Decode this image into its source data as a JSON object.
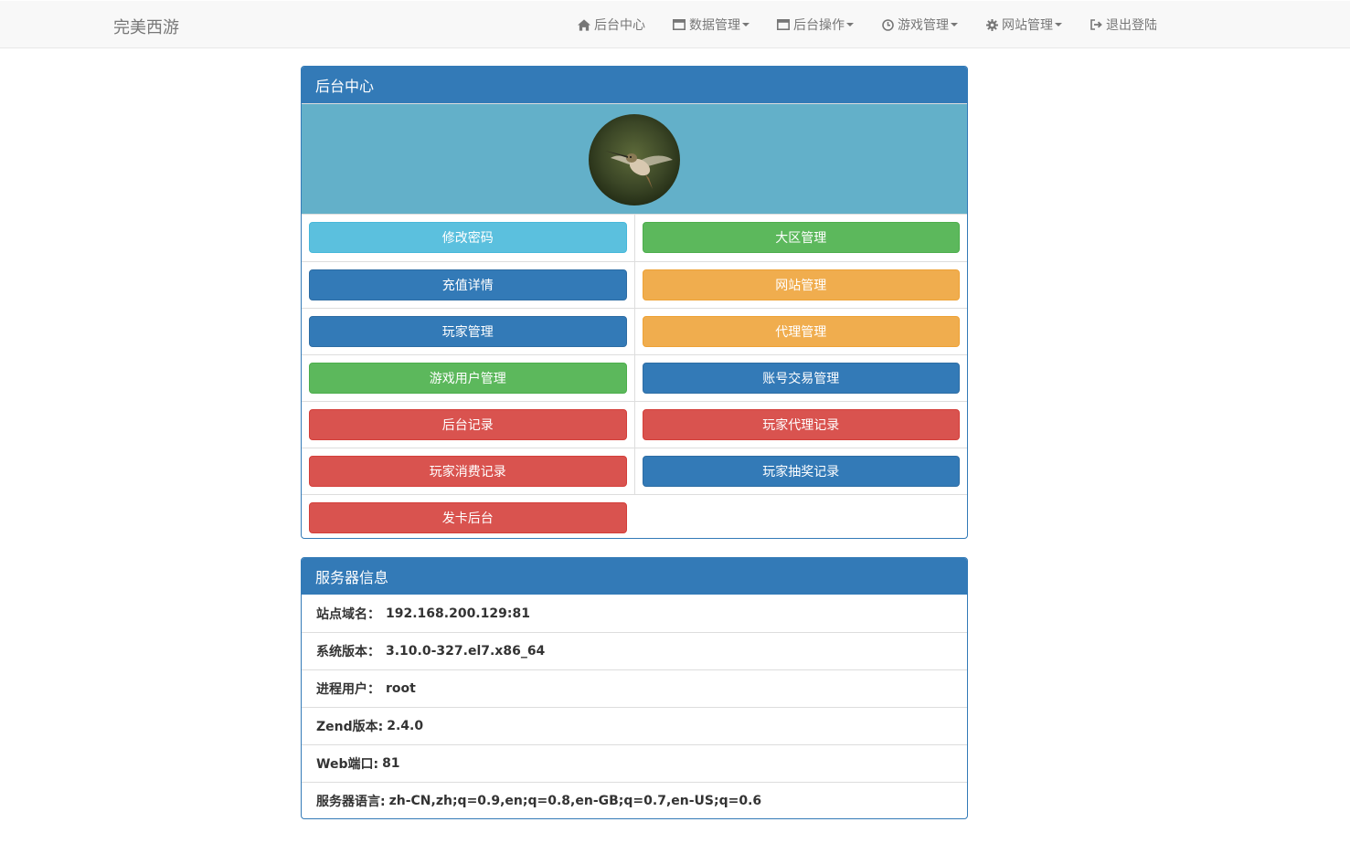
{
  "navbar": {
    "brand": "完美西游",
    "items": [
      {
        "label": "后台中心",
        "icon": "home-icon",
        "dropdown": false
      },
      {
        "label": "数据管理",
        "icon": "window-icon",
        "dropdown": true
      },
      {
        "label": "后台操作",
        "icon": "window-icon",
        "dropdown": true
      },
      {
        "label": "游戏管理",
        "icon": "clock-icon",
        "dropdown": true
      },
      {
        "label": "网站管理",
        "icon": "gear-icon",
        "dropdown": true
      },
      {
        "label": "退出登陆",
        "icon": "logout-icon",
        "dropdown": false
      }
    ]
  },
  "dashboard": {
    "title": "后台中心",
    "buttons": [
      [
        "修改密码",
        "大区管理"
      ],
      [
        "充值详情",
        "网站管理"
      ],
      [
        "玩家管理",
        "代理管理"
      ],
      [
        "游戏用户管理",
        "账号交易管理"
      ],
      [
        "后台记录",
        "玩家代理记录"
      ],
      [
        "玩家消费记录",
        "玩家抽奖记录"
      ],
      [
        "发卡后台",
        ""
      ]
    ]
  },
  "server_info": {
    "title": "服务器信息",
    "rows": [
      {
        "label": "站点域名：",
        "value": "192.168.200.129:81"
      },
      {
        "label": "系统版本：",
        "value": "3.10.0-327.el7.x86_64"
      },
      {
        "label": "进程用户：",
        "value": "root"
      },
      {
        "label": "Zend版本:",
        "value": "2.4.0"
      },
      {
        "label": "Web端口:",
        "value": "81"
      },
      {
        "label": "服务器语言:",
        "value": "zh-CN,zh;q=0.9,en;q=0.8,en-GB;q=0.7,en-US;q=0.6"
      }
    ]
  },
  "colors": {
    "primary": "#337ab7",
    "info": "#5bc0de",
    "success": "#5cb85c",
    "warning": "#f0ad4e",
    "danger": "#d9534f",
    "banner": "#63b0c9"
  }
}
